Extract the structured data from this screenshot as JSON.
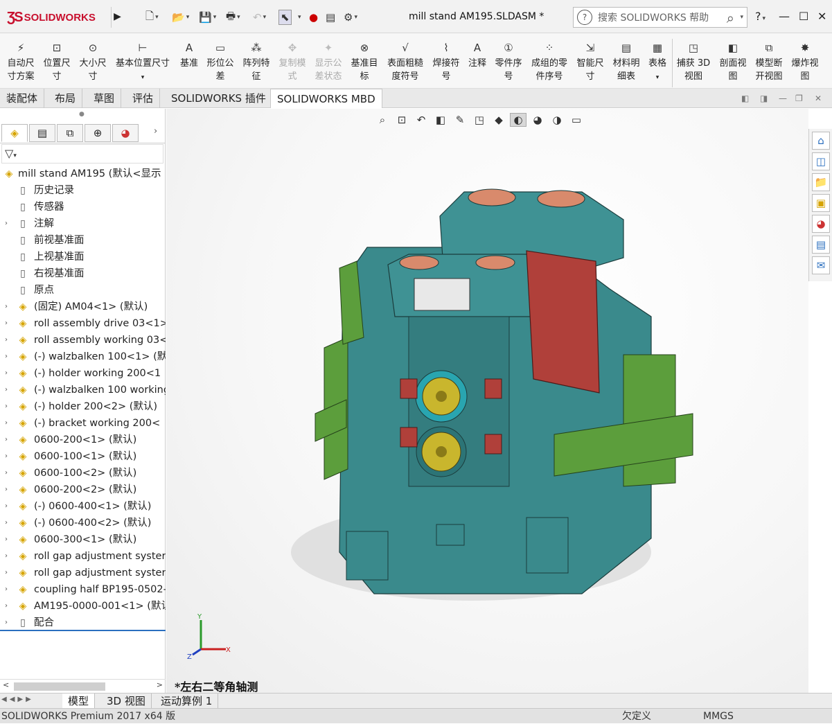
{
  "app": {
    "logo": "SOLIDWORKS",
    "document_title": "mill stand AM195.SLDASM *",
    "search_placeholder": "搜索 SOLIDWORKS 帮助",
    "help": "?",
    "minimize": "—",
    "maximize": "☐",
    "close": "✕"
  },
  "commands": [
    {
      "label": "自动尺寸方案",
      "icon": "auto-dim-icon",
      "glyph": "⚡",
      "enabled": true
    },
    {
      "label": "位置尺寸",
      "icon": "location-dim-icon",
      "glyph": "⊡",
      "enabled": true
    },
    {
      "label": "大小尺寸",
      "icon": "size-dim-icon",
      "glyph": "⊙",
      "enabled": true
    },
    {
      "label": "基本位置尺寸",
      "icon": "basic-location-icon",
      "glyph": "⊢",
      "enabled": true
    },
    {
      "label": "基准",
      "icon": "datum-icon",
      "glyph": "A",
      "enabled": true
    },
    {
      "label": "形位公差",
      "icon": "geometric-tolerance-icon",
      "glyph": "▭",
      "enabled": true
    },
    {
      "label": "阵列特征",
      "icon": "pattern-feature-icon",
      "glyph": "⁂",
      "enabled": true
    },
    {
      "label": "复制模式",
      "icon": "copy-scheme-icon",
      "glyph": "✥",
      "enabled": false
    },
    {
      "label": "显示公差状态",
      "icon": "tolerance-status-icon",
      "glyph": "✦",
      "enabled": false
    },
    {
      "label": "基准目标",
      "icon": "datum-target-icon",
      "glyph": "⊗",
      "enabled": true
    },
    {
      "label": "表面粗糙度符号",
      "icon": "surface-finish-icon",
      "glyph": "√",
      "enabled": true
    },
    {
      "label": "焊接符号",
      "icon": "weld-symbol-icon",
      "glyph": "⌇",
      "enabled": true
    },
    {
      "label": "注释",
      "icon": "note-icon",
      "glyph": "A",
      "enabled": true
    },
    {
      "label": "零件序号",
      "icon": "balloon-icon",
      "glyph": "①",
      "enabled": true
    },
    {
      "label": "成组的零件序号",
      "icon": "stacked-balloon-icon",
      "glyph": "⁘",
      "enabled": true
    },
    {
      "label": "智能尺寸",
      "icon": "smart-dim-icon",
      "glyph": "⇲",
      "enabled": true
    },
    {
      "label": "材料明细表",
      "icon": "bom-icon",
      "glyph": "▤",
      "enabled": true
    },
    {
      "label": "表格",
      "icon": "table-icon",
      "glyph": "▦",
      "enabled": true
    },
    {
      "label": "捕获 3D 视图",
      "icon": "capture-3d-icon",
      "glyph": "◳",
      "enabled": true
    },
    {
      "label": "剖面视图",
      "icon": "section-view-icon",
      "glyph": "◧",
      "enabled": true
    },
    {
      "label": "模型断开视图",
      "icon": "break-view-icon",
      "glyph": "⧉",
      "enabled": true
    },
    {
      "label": "爆炸视图",
      "icon": "exploded-view-icon",
      "glyph": "✸",
      "enabled": true
    }
  ],
  "tabs": [
    "装配体",
    "布局",
    "草图",
    "评估",
    "SOLIDWORKS 插件",
    "SOLIDWORKS MBD"
  ],
  "tree": {
    "filter": "▽",
    "root": "mill stand AM195  (默认<显示",
    "items": [
      {
        "label": "历史记录",
        "type": "feat",
        "expand": false
      },
      {
        "label": "传感器",
        "type": "feat",
        "expand": false
      },
      {
        "label": "注解",
        "type": "feat",
        "expand": true
      },
      {
        "label": "前视基准面",
        "type": "feat",
        "expand": false
      },
      {
        "label": "上视基准面",
        "type": "feat",
        "expand": false
      },
      {
        "label": "右视基准面",
        "type": "feat",
        "expand": false
      },
      {
        "label": "原点",
        "type": "feat",
        "expand": false
      },
      {
        "label": "(固定) AM04<1> (默认)",
        "type": "part",
        "expand": true
      },
      {
        "label": "roll assembly drive 03<1>",
        "type": "part",
        "expand": true
      },
      {
        "label": "roll assembly working 03<",
        "type": "part",
        "expand": true
      },
      {
        "label": "(-) walzbalken 100<1> (默认",
        "type": "part",
        "expand": true
      },
      {
        "label": "(-) holder working  200<1",
        "type": "part",
        "expand": true
      },
      {
        "label": "(-) walzbalken 100 working",
        "type": "part",
        "expand": true
      },
      {
        "label": "(-) holder 200<2> (默认)",
        "type": "part",
        "expand": true
      },
      {
        "label": "(-) bracket working  200<",
        "type": "part",
        "expand": true
      },
      {
        "label": "0600-200<1> (默认)",
        "type": "part",
        "expand": true
      },
      {
        "label": "0600-100<1> (默认)",
        "type": "part",
        "expand": true
      },
      {
        "label": "0600-100<2> (默认)",
        "type": "part",
        "expand": true
      },
      {
        "label": "0600-200<2> (默认)",
        "type": "part",
        "expand": true
      },
      {
        "label": "(-) 0600-400<1> (默认)",
        "type": "part",
        "expand": true
      },
      {
        "label": "(-) 0600-400<2> (默认)",
        "type": "part",
        "expand": true
      },
      {
        "label": "0600-300<1> (默认)",
        "type": "part",
        "expand": true
      },
      {
        "label": "roll gap adjustment syster",
        "type": "part",
        "expand": true
      },
      {
        "label": "roll gap adjustment syster",
        "type": "part",
        "expand": true
      },
      {
        "label": "coupling half BP195-0502-",
        "type": "part",
        "expand": true
      },
      {
        "label": "AM195-0000-001<1> (默认",
        "type": "part",
        "expand": true
      },
      {
        "label": "配合",
        "type": "feat",
        "expand": true
      }
    ]
  },
  "viewport": {
    "view_label": "*左右二等角轴测",
    "triad": {
      "x": "X",
      "y": "Y",
      "z": "Z"
    },
    "colors": {
      "teal": "#3a8a8c",
      "green": "#5c9e3c",
      "red": "#b0403a",
      "yellow": "#c9b62d"
    }
  },
  "bottom_tabs": [
    "模型",
    "3D 视图",
    "运动算例 1"
  ],
  "status": {
    "app": "SOLIDWORKS Premium 2017 x64 版",
    "custom": "欠定义",
    "units": "MMGS"
  }
}
